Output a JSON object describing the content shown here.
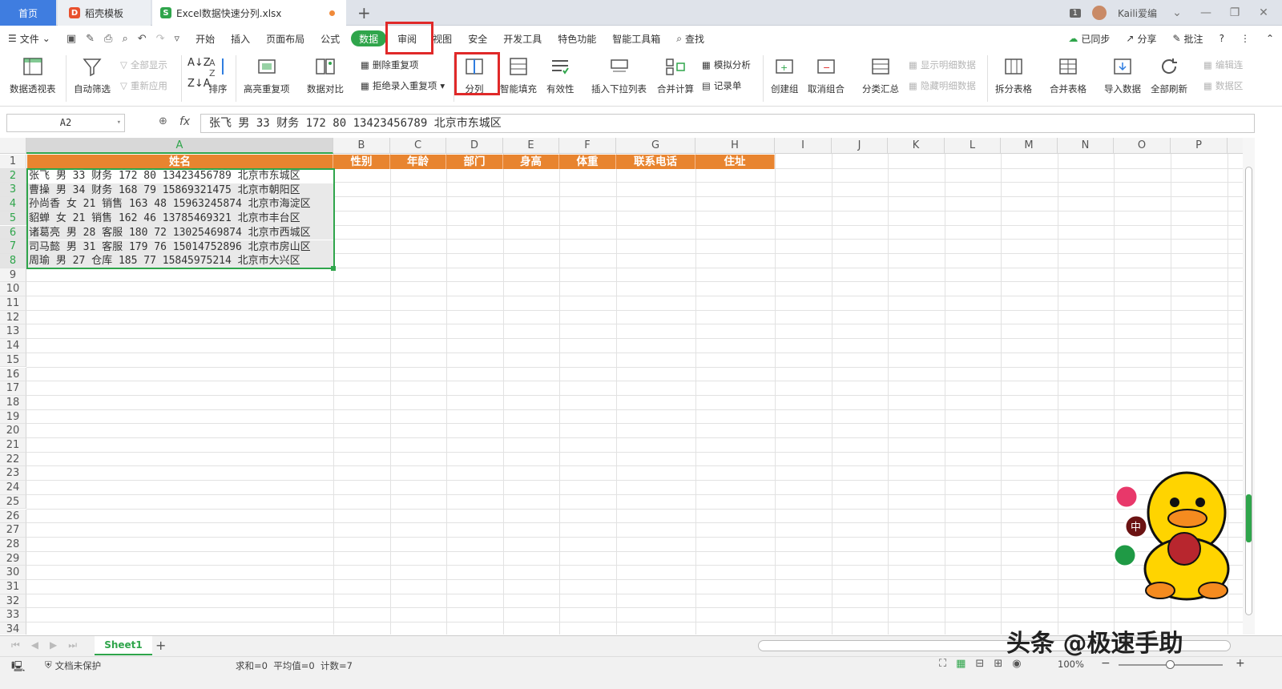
{
  "tabs": {
    "home": "首页",
    "template": "稻壳模板",
    "file": "Excel数据快速分列.xlsx",
    "new_tab": "+"
  },
  "window": {
    "badge": "1",
    "user": "Kaili爱编"
  },
  "menu": {
    "file": "文件",
    "items": [
      "开始",
      "插入",
      "页面布局",
      "公式",
      "数据",
      "审阅",
      "视图",
      "安全",
      "开发工具",
      "特色功能",
      "智能工具箱"
    ],
    "search": "查找",
    "sync": "已同步",
    "share": "分享",
    "comment": "批注"
  },
  "ribbon": {
    "pivot": "数据透视表",
    "autofilter": "自动筛选",
    "show_all": "全部显示",
    "reapply": "重新应用",
    "sort": "排序",
    "highlight_dup": "高亮重复项",
    "compare": "数据对比",
    "remove_dup": "删除重复项",
    "reject_dup": "拒绝录入重复项",
    "split": "分列",
    "smart_fill": "智能填充",
    "validity": "有效性",
    "dropdown": "插入下拉列表",
    "consolidate": "合并计算",
    "simulate": "模拟分析",
    "record": "记录单",
    "group": "创建组",
    "ungroup": "取消组合",
    "subtotal": "分类汇总",
    "show_detail": "显示明细数据",
    "hide_detail": "隐藏明细数据",
    "split_table": "拆分表格",
    "merge_table": "合并表格",
    "import": "导入数据",
    "refresh_all": "全部刷新",
    "edit_link": "编辑连",
    "data_src": "数据区"
  },
  "formula_bar": {
    "name_box": "A2",
    "fx": "fx",
    "content": "张飞 男 33 财务 172 80 13423456789 北京市东城区"
  },
  "columns": [
    "A",
    "B",
    "C",
    "D",
    "E",
    "F",
    "G",
    "H",
    "I",
    "J",
    "K",
    "L",
    "M",
    "N",
    "O",
    "P"
  ],
  "rows": [
    "1",
    "2",
    "3",
    "4",
    "5",
    "6",
    "7",
    "8",
    "9",
    "10",
    "11",
    "12",
    "13",
    "14",
    "15",
    "16",
    "17",
    "18",
    "19",
    "20",
    "21",
    "22",
    "23",
    "24",
    "25",
    "26",
    "27",
    "28",
    "29",
    "30",
    "31",
    "32",
    "33",
    "34"
  ],
  "header_cells": [
    "姓名",
    "性别",
    "年龄",
    "部门",
    "身高",
    "体重",
    "联系电话",
    "住址"
  ],
  "data_rows": [
    "张飞 男 33 财务 172 80 13423456789 北京市东城区",
    "曹操 男 34 财务 168 79 15869321475 北京市朝阳区",
    "孙尚香 女 21 销售 163 48 15963245874 北京市海淀区",
    "貂蝉 女 21 销售 162 46 13785469321 北京市丰台区",
    "诸葛亮 男 28 客服 180 72 13025469874 北京市西城区",
    "司马懿 男 31 客服 179 76 15014752896 北京市房山区",
    "周瑜 男 27 仓库 185 77 15845975214 北京市大兴区"
  ],
  "sheet": {
    "name": "Sheet1"
  },
  "status": {
    "protect": "文档未保护",
    "stats": "求和=0  平均值=0  计数=7",
    "zoom": "100%"
  },
  "watermark": "头条 @极速手助",
  "colors": {
    "accent": "#2fa54b",
    "header_fill": "#e8842f",
    "highlight": "#e02929"
  }
}
